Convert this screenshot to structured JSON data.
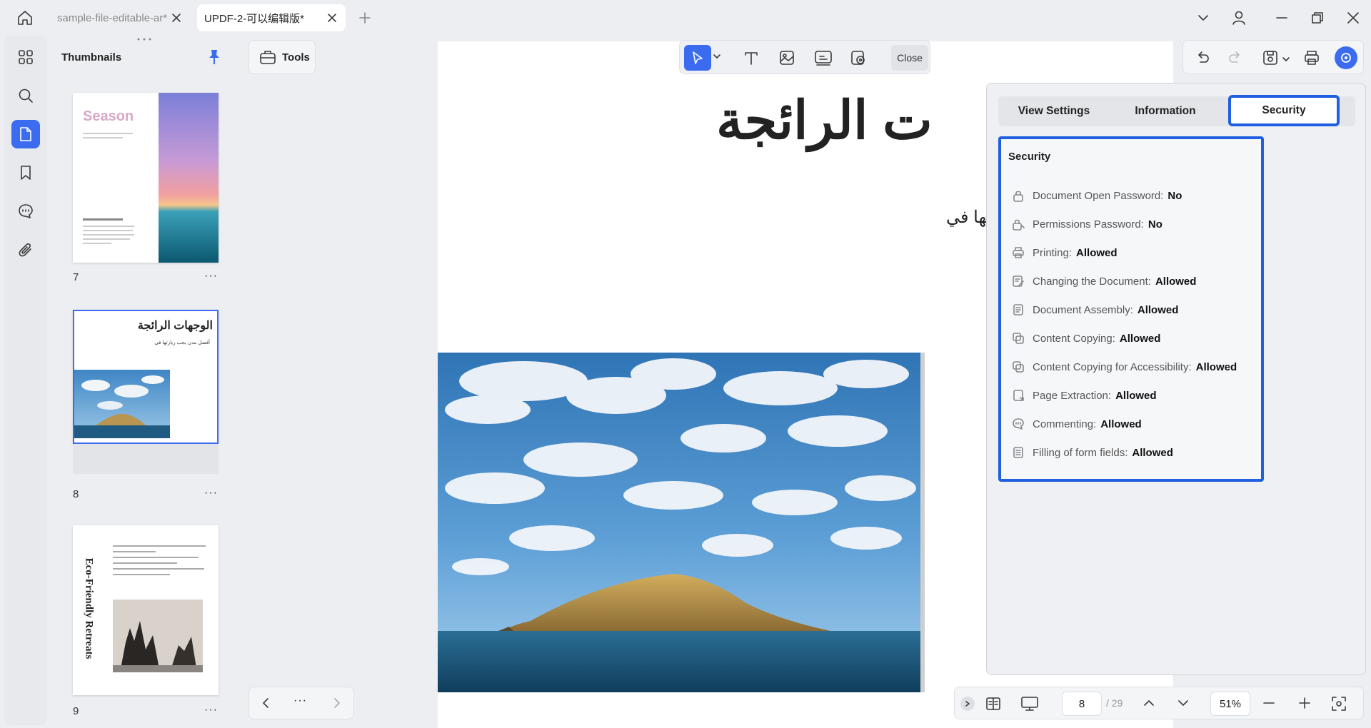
{
  "tabs": [
    {
      "label": "sample-file-editable-ar*"
    },
    {
      "label": "UPDF-2-可以编辑版*"
    }
  ],
  "sidebar": {
    "title": "Thumbnails",
    "pages": [
      {
        "number": "7",
        "thumb_title": "Season"
      },
      {
        "number": "8",
        "thumb_title": "الوجهات الرائجة",
        "thumb_subtitle": "أفضل مدن يجب زيارتها في"
      },
      {
        "number": "9",
        "thumb_title": "Eco-Friendly Retreats"
      }
    ],
    "more_glyph": "···"
  },
  "tools": {
    "label": "Tools"
  },
  "edit_toolbar": {
    "close_label": "Close"
  },
  "document": {
    "heading": "ت الرائجة",
    "subtext": "تها في"
  },
  "properties": {
    "tabs": [
      "View Settings",
      "Information",
      "Security"
    ],
    "active_tab": "Security",
    "section_title": "Security",
    "rows": [
      {
        "label": "Document Open Password:",
        "value": "No",
        "icon": "lock-icon"
      },
      {
        "label": "Permissions Password:",
        "value": "No",
        "icon": "key-lock-icon"
      },
      {
        "label": "Printing:",
        "value": "Allowed",
        "icon": "printer-icon"
      },
      {
        "label": "Changing the Document:",
        "value": "Allowed",
        "icon": "edit-document-icon"
      },
      {
        "label": "Document Assembly:",
        "value": "Allowed",
        "icon": "document-icon"
      },
      {
        "label": "Content Copying:",
        "value": "Allowed",
        "icon": "copy-icon"
      },
      {
        "label": "Content Copying for Accessibility:",
        "value": "Allowed",
        "icon": "copy-icon"
      },
      {
        "label": "Page Extraction:",
        "value": "Allowed",
        "icon": "page-extract-icon"
      },
      {
        "label": "Commenting:",
        "value": "Allowed",
        "icon": "comment-icon"
      },
      {
        "label": "Filling of form fields:",
        "value": "Allowed",
        "icon": "form-icon"
      }
    ]
  },
  "status": {
    "current_page": "8",
    "total_pages": "/ 29",
    "zoom": "51%"
  },
  "colors": {
    "accent": "#1f5fe0",
    "active_rail": "#3b6cf0"
  }
}
